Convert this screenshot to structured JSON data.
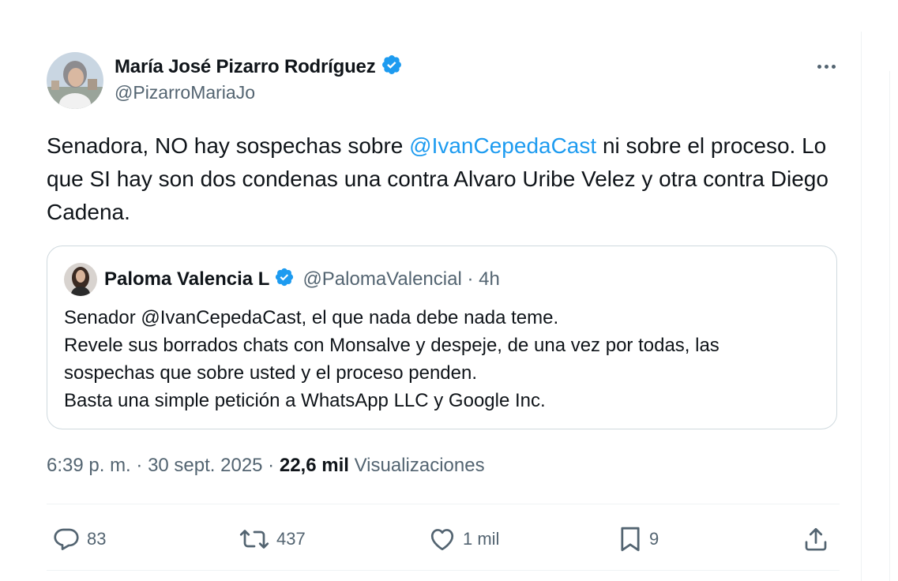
{
  "author": {
    "display_name": "María José Pizarro Rodríguez",
    "handle": "@PizarroMariaJo",
    "verified": true
  },
  "tweet": {
    "text_before": "Senadora, NO hay sospechas sobre ",
    "mention": "@IvanCepedaCast",
    "text_after": " ni sobre el proceso. Lo que SI hay son dos condenas una contra Alvaro Uribe Velez y otra contra Diego Cadena."
  },
  "quoted": {
    "display_name": "Paloma Valencia L",
    "handle": "@PalomaValencial",
    "time": "4h",
    "lines": [
      "Senador @IvanCepedaCast, el que nada debe nada teme.",
      "Revele sus borrados chats con Monsalve y despeje, de una vez por todas, las",
      "sospechas que sobre usted y el proceso penden.",
      "Basta una simple petición a WhatsApp LLC y Google Inc."
    ]
  },
  "meta": {
    "time": "6:39 p. m.",
    "date": "30 sept. 2025",
    "views_count": "22,6 mil",
    "views_label": "Visualizaciones"
  },
  "actions": {
    "replies": "83",
    "reposts": "437",
    "likes": "1 mil",
    "bookmarks": "9"
  },
  "colors": {
    "accent": "#1d9bf0",
    "secondary_text": "#536471",
    "border": "#cfd9de"
  },
  "icons": [
    "verified-badge-icon",
    "more-icon",
    "reply-icon",
    "repost-icon",
    "like-icon",
    "bookmark-icon",
    "share-icon"
  ]
}
